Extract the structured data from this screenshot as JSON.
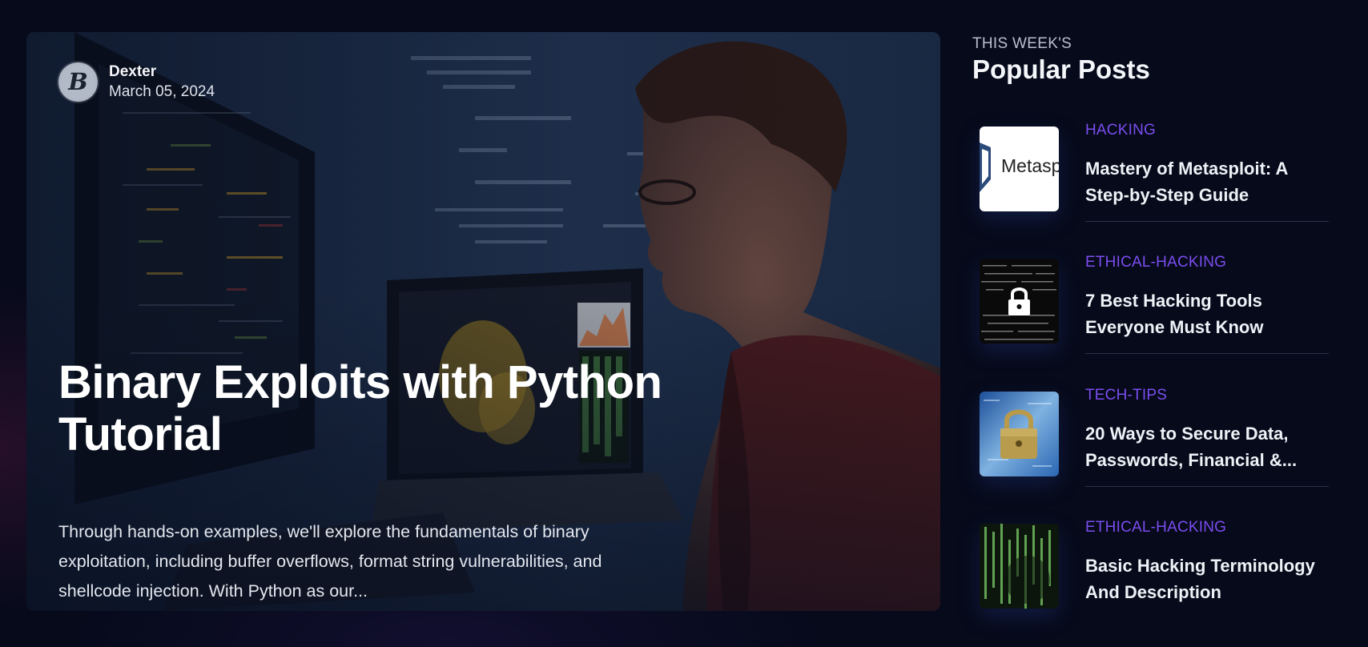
{
  "hero": {
    "author_name": "Dexter",
    "author_date": "March 05, 2024",
    "avatar_letter": "B",
    "title": "Binary Exploits with Python Tutorial",
    "excerpt": "Through hands-on examples, we'll explore the fundamentals of binary exploitation, including buffer overflows, format string vulnerabilities, and shellcode injection. With Python as our..."
  },
  "sidebar": {
    "eyebrow": "THIS WEEK'S",
    "title": "Popular Posts",
    "posts": [
      {
        "category": "HACKING",
        "title": "Mastery of Metasploit: A Step-by-Step Guide",
        "thumb_text": "Metasp",
        "thumb": "metasploit-logo"
      },
      {
        "category": "ETHICAL-HACKING",
        "title": "7 Best Hacking Tools Everyone Must Know",
        "thumb": "padlock-code"
      },
      {
        "category": "TECH-TIPS",
        "title": "20 Ways to Secure Data, Passwords, Financial &...",
        "thumb": "padlock-blue"
      },
      {
        "category": "ETHICAL-HACKING",
        "title": "Basic Hacking Terminology And Description",
        "thumb": "matrix-code"
      }
    ]
  },
  "colors": {
    "background": "#060a1a",
    "category_accent": "#7b4df0",
    "text_primary": "#f4f6fa"
  }
}
